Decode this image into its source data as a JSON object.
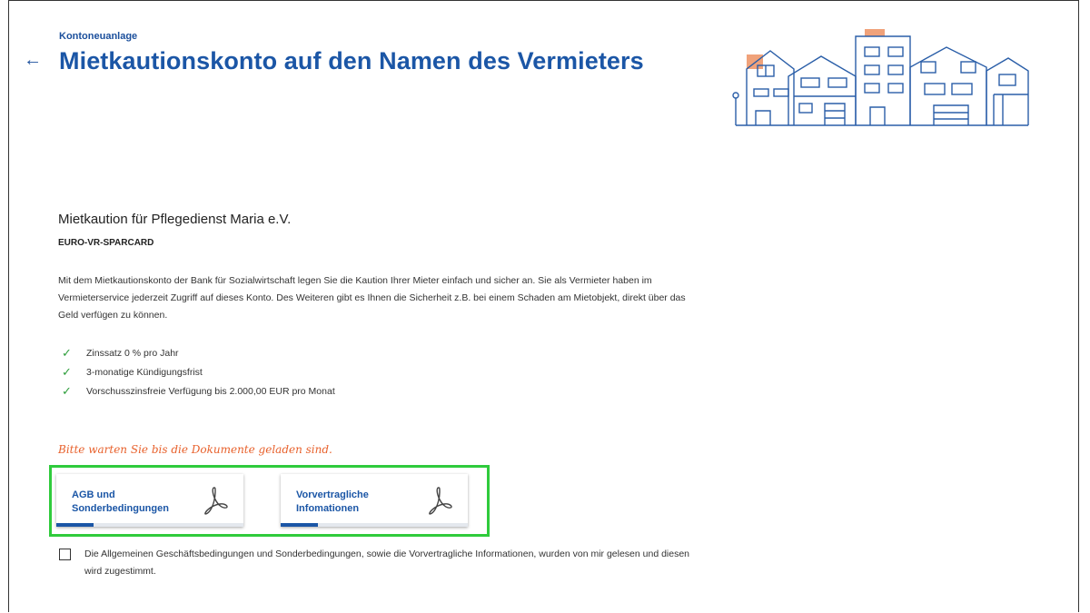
{
  "header": {
    "breadcrumb": "Kontoneuanlage",
    "back_icon": "arrow-left-icon",
    "title": "Mietkautionskonto auf den Namen des Vermieters"
  },
  "product": {
    "name": "Mietkaution für Pflegedienst Maria e.V.",
    "type": "EURO-VR-SPARCARD",
    "description": "Mit dem Mietkautionskonto der Bank für Sozialwirtschaft legen Sie die Kaution Ihrer Mieter einfach und sicher an. Sie als Vermieter haben im Vermieterservice jederzeit Zugriff auf dieses Konto. Des Weiteren gibt es Ihnen die Sicherheit z.B. bei einem Schaden am Mietobjekt, direkt über das Geld verfügen zu können.",
    "features": [
      "Zinssatz 0 % pro Jahr",
      "3-monatige Kündigungsfrist",
      "Vorschusszinsfreie Verfügung bis 2.000,00 EUR pro Monat"
    ]
  },
  "documents": {
    "loading_note": "Bitte warten Sie bis die Dokumente geladen sind.",
    "items": [
      {
        "line1": "AGB und",
        "line2": "Sonderbedingungen",
        "icon": "pdf-icon",
        "progress": 0.2
      },
      {
        "line1": "Vorvertragliche",
        "line2": "Infomationen",
        "icon": "pdf-icon",
        "progress": 0.2
      }
    ]
  },
  "consent": {
    "checked": false,
    "text": "Die Allgemeinen Geschäftsbedingungen und Sonderbedingungen, sowie die Vorvertragliche Informationen, wurden von mir gelesen und diesen wird zugestimmt."
  },
  "colors": {
    "primary": "#1b56a6",
    "accent_orange": "#e8612c",
    "check_green": "#2e9e3c",
    "highlight_green": "#2fcb3c"
  }
}
